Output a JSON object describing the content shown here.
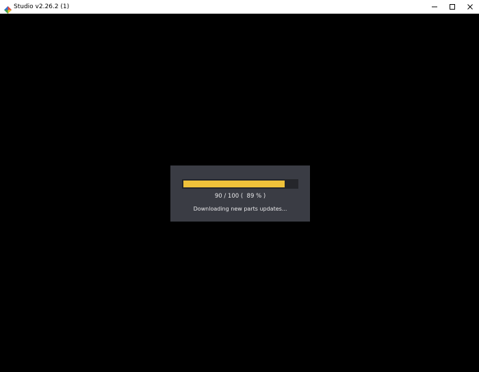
{
  "window": {
    "title": "Studio v2.26.2 (1)",
    "controls": {
      "minimize": "minimize-icon",
      "maximize": "maximize-icon",
      "close": "close-icon"
    }
  },
  "loader": {
    "progress_text": "90 / 100 (  89 % )",
    "status": "Downloading new parts updates...",
    "progress_fraction": 0.89,
    "colors": {
      "fill": "#f0c23a",
      "track": "#25262b",
      "panel": "#3a3c44",
      "background": "#000000"
    }
  }
}
